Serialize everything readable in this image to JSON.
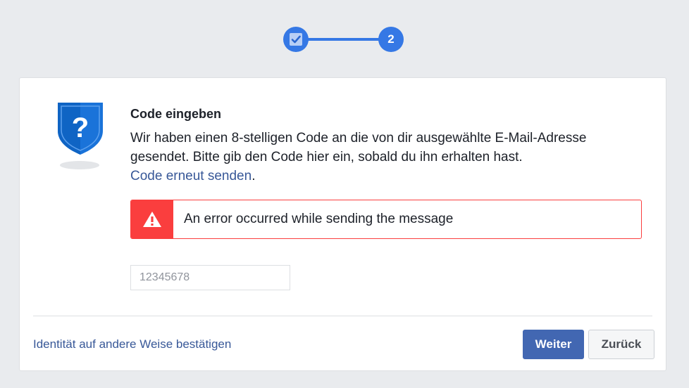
{
  "stepper": {
    "step1_state": "completed",
    "step2_label": "2",
    "accent_color": "#3578e5"
  },
  "card": {
    "title": "Code eingeben",
    "description": "Wir haben einen 8-stelligen Code an die von dir ausgewählte E-Mail-Adresse gesendet. Bitte gib den Code hier ein, sobald du ihn erhalten hast.",
    "resend_link": "Code erneut senden",
    "resend_suffix": ".",
    "icon": "shield-question-icon"
  },
  "error": {
    "message": "An error occurred while sending the message",
    "icon": "warning-icon",
    "color": "#fa3e3e"
  },
  "code_input": {
    "value": "",
    "placeholder": "12345678"
  },
  "footer": {
    "alt_link": "Identität auf andere Weise bestätigen",
    "primary_button": "Weiter",
    "secondary_button": "Zurück",
    "primary_color": "#4267b2"
  }
}
